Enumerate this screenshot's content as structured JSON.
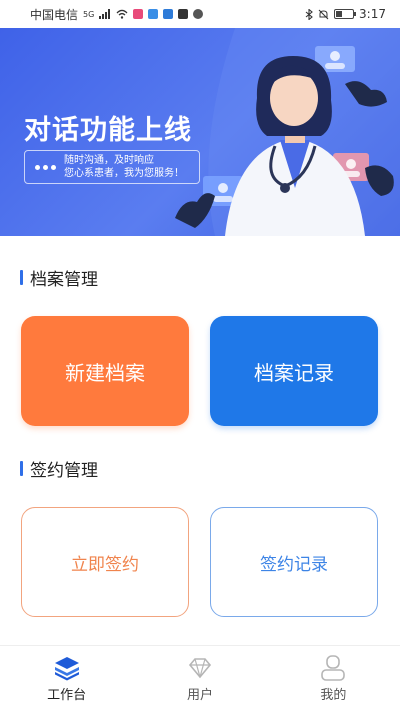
{
  "status_bar": {
    "carrier": "中国电信",
    "network": "5G",
    "time": "3:17",
    "battery_level": 0.4,
    "icons": [
      "signal-icon",
      "wifi-icon",
      "app-icon",
      "app-icon",
      "app-icon",
      "app-icon",
      "app-icon",
      "bluetooth-icon",
      "mute-icon",
      "battery-icon"
    ]
  },
  "banner": {
    "title": "对话功能上线",
    "subtitle_line1": "随时沟通，及时响应",
    "subtitle_line2": "您心系患者，我为您服务！",
    "colors": {
      "background": "#3f62e8"
    }
  },
  "archive_section": {
    "heading": "档案管理",
    "new_archive_label": "新建档案",
    "archive_records_label": "档案记录"
  },
  "sign_section": {
    "heading": "签约管理",
    "sign_now_label": "立即签约",
    "sign_records_label": "签约记录"
  },
  "bottom_nav": {
    "items": [
      {
        "label": "工作台",
        "icon": "layers-icon",
        "active": true
      },
      {
        "label": "用户",
        "icon": "diamond-icon",
        "active": false
      },
      {
        "label": "我的",
        "icon": "person-icon",
        "active": false
      }
    ],
    "colors": {
      "active": "#1f5bd8",
      "inactive": "#9a9a9a"
    }
  },
  "colors": {
    "accent_blue": "#1f78e8",
    "accent_orange": "#ff7a3d"
  }
}
